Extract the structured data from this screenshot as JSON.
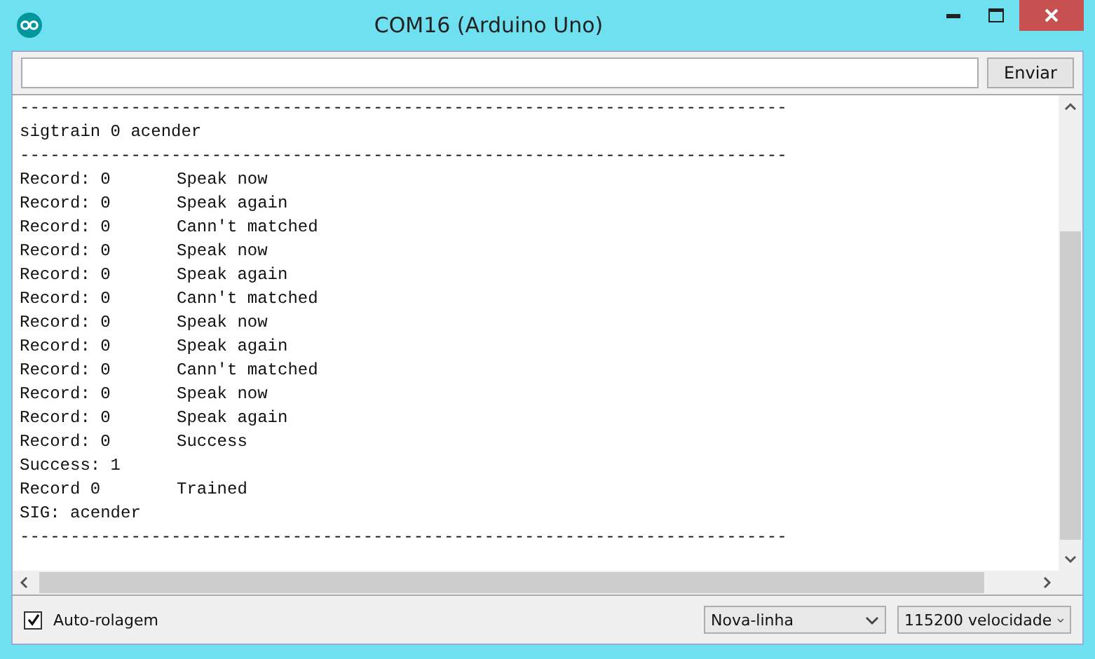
{
  "window": {
    "title": "COM16 (Arduino Uno)"
  },
  "send_bar": {
    "button": "Enviar"
  },
  "output_lines": [
    {
      "text": "----------------------------------------------------------------------------"
    },
    {
      "text": "sigtrain 0 acender"
    },
    {
      "text": "----------------------------------------------------------------------------"
    },
    {
      "text": "Record: 0",
      "message": "Speak now"
    },
    {
      "text": "Record: 0",
      "message": "Speak again"
    },
    {
      "text": "Record: 0",
      "message": "Cann't matched"
    },
    {
      "text": "Record: 0",
      "message": "Speak now"
    },
    {
      "text": "Record: 0",
      "message": "Speak again"
    },
    {
      "text": "Record: 0",
      "message": "Cann't matched"
    },
    {
      "text": "Record: 0",
      "message": "Speak now"
    },
    {
      "text": "Record: 0",
      "message": "Speak again"
    },
    {
      "text": "Record: 0",
      "message": "Cann't matched"
    },
    {
      "text": "Record: 0",
      "message": "Speak now"
    },
    {
      "text": "Record: 0",
      "message": "Speak again"
    },
    {
      "text": "Record: 0",
      "message": "Success"
    },
    {
      "text": "Success: 1"
    },
    {
      "text": "Record 0",
      "message": "Trained"
    },
    {
      "text": "SIG: acender"
    },
    {
      "text": "----------------------------------------------------------------------------"
    }
  ],
  "footer": {
    "autoscroll": {
      "label": "Auto-rolagem",
      "checked": true
    },
    "line_ending": "Nova-linha",
    "baud_rate": "115200 velocidade"
  }
}
